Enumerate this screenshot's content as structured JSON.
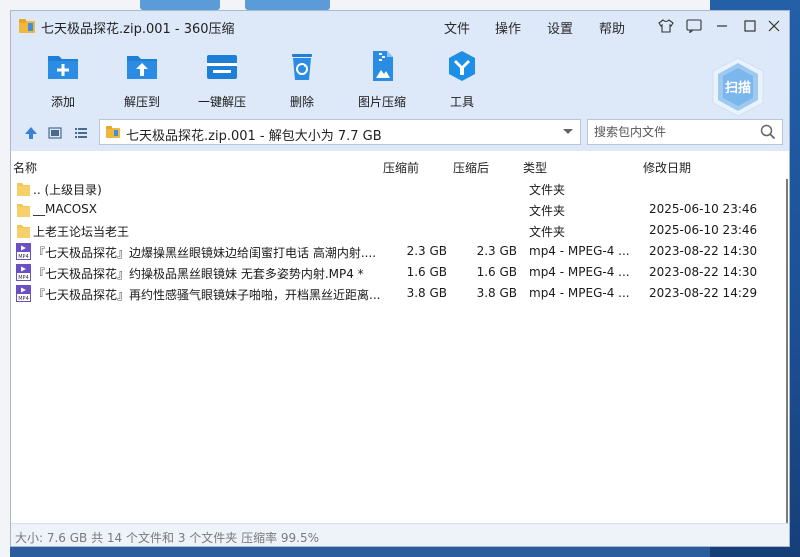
{
  "window": {
    "title": "七天极品探花.zip.001 - 360压缩"
  },
  "menu": {
    "file": "文件",
    "operate": "操作",
    "settings": "设置",
    "help": "帮助"
  },
  "toolbar": {
    "add": "添加",
    "extract_to": "解压到",
    "one_click_extract": "一键解压",
    "delete": "删除",
    "image_compress": "图片压缩",
    "tools": "工具",
    "scan": "扫描"
  },
  "address": {
    "path": "七天极品探花.zip.001 - 解包大小为 7.7 GB",
    "search_placeholder": "搜索包内文件"
  },
  "columns": {
    "name": "名称",
    "packed": "压缩前",
    "size": "压缩后",
    "type": "类型",
    "modified": "修改日期"
  },
  "files": [
    {
      "icon": "folder",
      "name": ".. (上级目录)",
      "packed": "",
      "size": "",
      "type": "文件夹",
      "modified": ""
    },
    {
      "icon": "folder",
      "name": "__MACOSX",
      "packed": "",
      "size": "",
      "type": "文件夹",
      "modified": "2025-06-10 23:46"
    },
    {
      "icon": "folder",
      "name": "上老王论坛当老王",
      "packed": "",
      "size": "",
      "type": "文件夹",
      "modified": "2025-06-10 23:46"
    },
    {
      "icon": "mp4",
      "name": "『七天极品探花』边爆操黑丝眼镜妹边给闺蜜打电话 高潮内射....",
      "packed": "2.3 GB",
      "size": "2.3 GB",
      "type": "mp4 - MPEG-4 ...",
      "modified": "2023-08-22 14:30"
    },
    {
      "icon": "mp4",
      "name": "『七天极品探花』约操极品黑丝眼镜妹 无套多姿势内射.MP4 *",
      "packed": "1.6 GB",
      "size": "1.6 GB",
      "type": "mp4 - MPEG-4 ...",
      "modified": "2023-08-22 14:30"
    },
    {
      "icon": "mp4",
      "name": "『七天极品探花』再约性感骚气眼镜妹子啪啪，开档黑丝近距离...",
      "packed": "3.8 GB",
      "size": "3.8 GB",
      "type": "mp4 - MPEG-4 ...",
      "modified": "2023-08-22 14:29"
    }
  ],
  "status": {
    "text": "大小: 7.6 GB 共 14 个文件和 3 个文件夹 压缩率 99.5%"
  },
  "colors": {
    "accent": "#1e7fd6",
    "header_bg": "#dde9f8",
    "folder": "#f3c658"
  }
}
